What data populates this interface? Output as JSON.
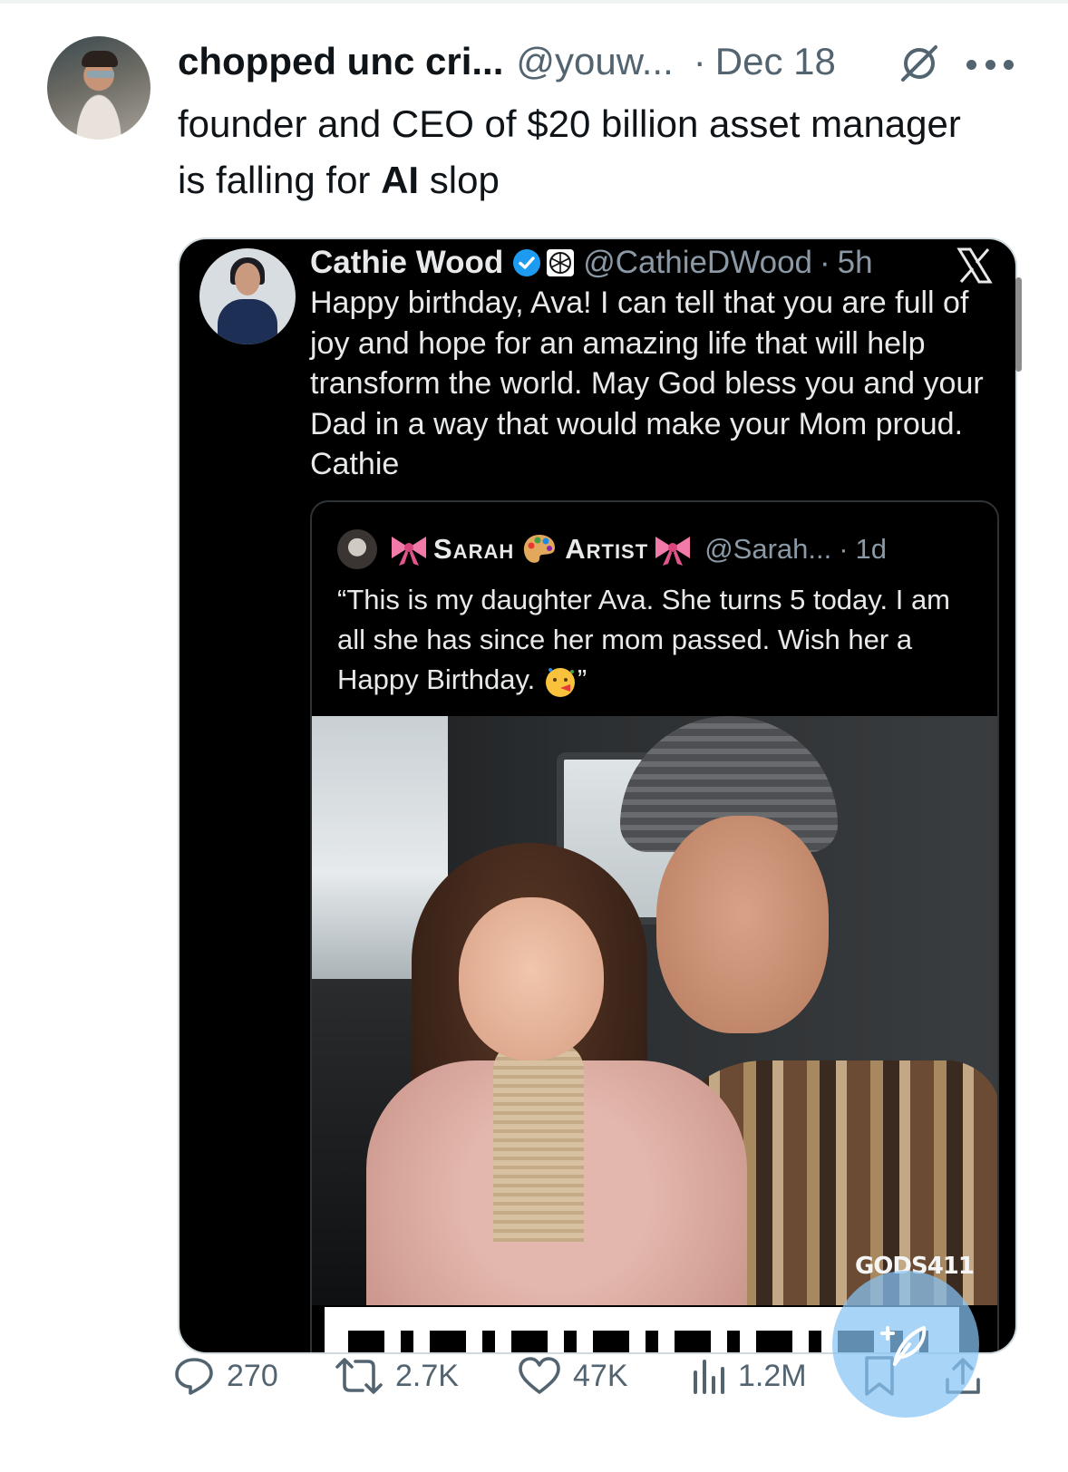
{
  "tweet": {
    "display_name": "chopped unc cri...",
    "handle": "@youw...",
    "separator": "·",
    "date": "Dec 18",
    "text_before": "founder and CEO of $20 billion asset manager is falling for ",
    "text_bold": "AI",
    "text_after": " slop"
  },
  "embedded": {
    "name": "Cathie Wood",
    "handle": "@CathieDWood",
    "separator": "·",
    "time": "5h",
    "text": "Happy birthday, Ava! I can tell that you are full of joy and hope for an amazing life that will help transform the world. May God bless you and your Dad in a way that would make your Mom proud. Cathie"
  },
  "quote": {
    "name_first": "Sarah",
    "name_second": "Artist",
    "handle": "@Sarah...",
    "separator": "·",
    "time": "1d",
    "text": "“This is my daughter Ava. She turns 5 today. I am all she has since her mom passed. Wish her a Happy Birthday.",
    "text_end": "”",
    "watermark": "GODS411"
  },
  "actions": {
    "replies": "270",
    "reposts": "2.7K",
    "likes": "47K",
    "views": "1.2M"
  },
  "colors": {
    "text_primary": "#0f1419",
    "text_secondary": "#536471",
    "verified": "#1d9bf0",
    "fab": "#86c4f5"
  },
  "icons": [
    "grok-icon",
    "more-icon",
    "verified-icon",
    "org-icon",
    "x-logo-icon",
    "bow-icon",
    "palette-icon",
    "party-icon",
    "reply-icon",
    "repost-icon",
    "like-icon",
    "views-icon",
    "bookmark-icon",
    "share-icon",
    "compose-icon"
  ]
}
